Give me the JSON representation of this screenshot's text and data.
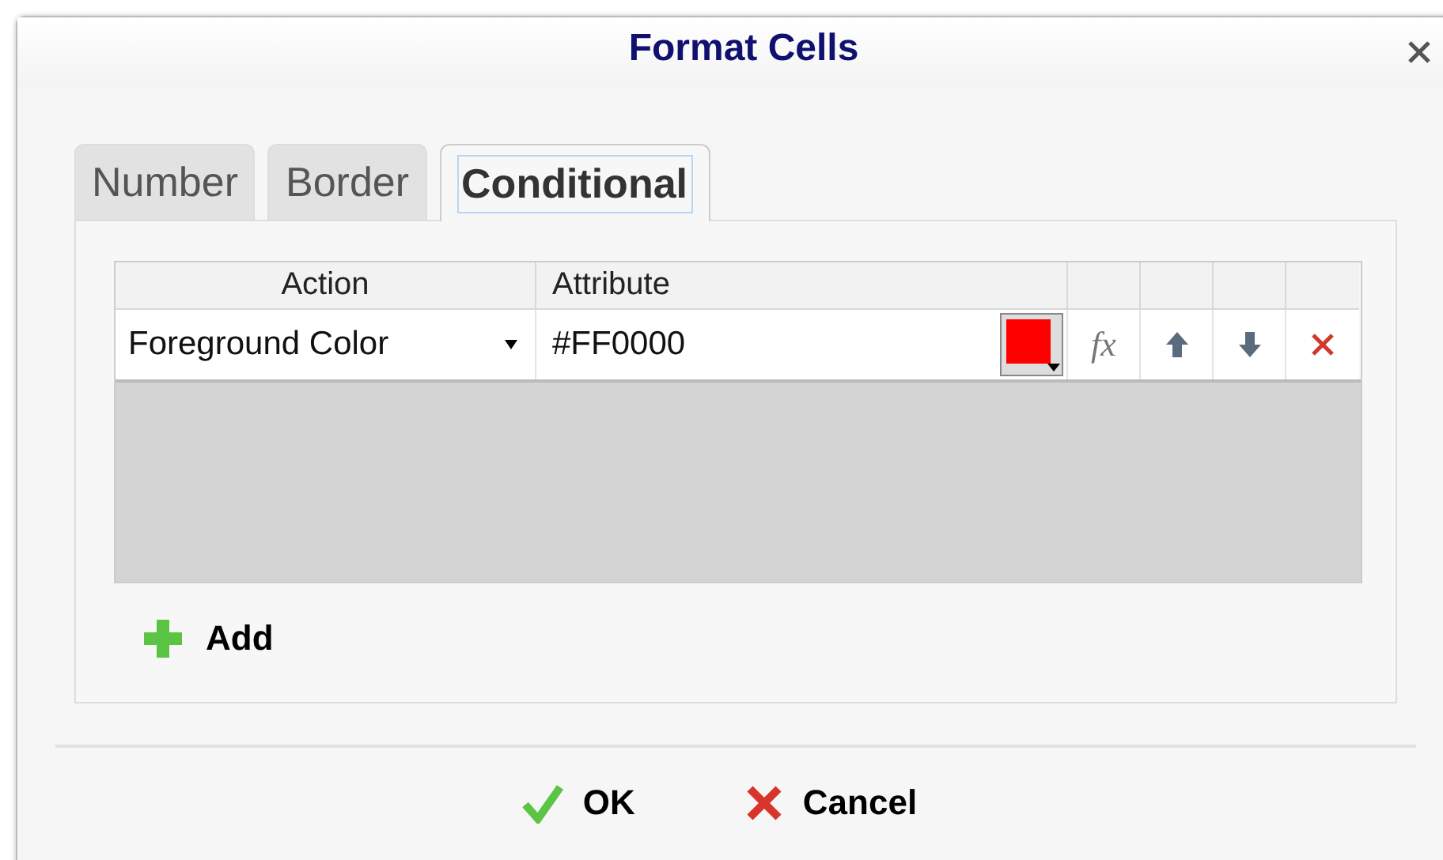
{
  "window": {
    "title": "Format Cells"
  },
  "tabs": [
    {
      "label": "Number",
      "selected": false
    },
    {
      "label": "Border",
      "selected": false
    },
    {
      "label": "Conditional",
      "selected": true
    }
  ],
  "table": {
    "columns": [
      "Action",
      "Attribute"
    ],
    "rows": [
      {
        "action": "Foreground Color",
        "attribute": "#FF0000",
        "color": "#ff0000",
        "function_label": "fx"
      }
    ]
  },
  "add_button": "Add",
  "buttons": [
    {
      "kind": "ok",
      "label": "OK"
    },
    {
      "kind": "cancel",
      "label": "Cancel"
    }
  ]
}
